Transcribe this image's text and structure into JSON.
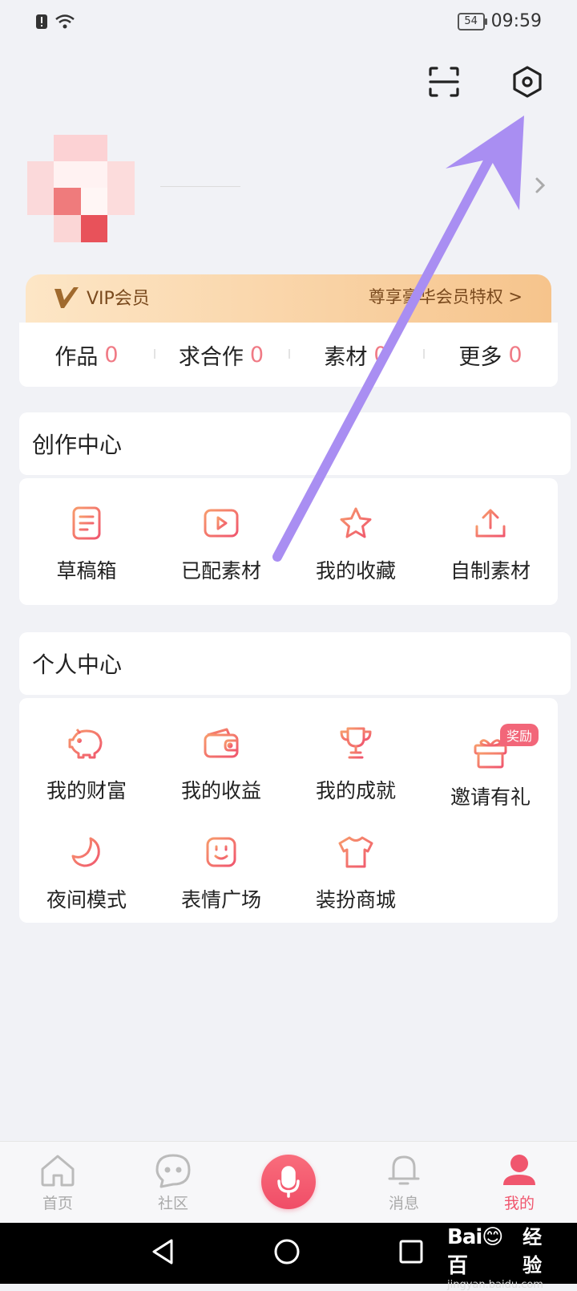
{
  "status_bar": {
    "battery": "54",
    "time": "09:59"
  },
  "icons": {
    "scan": "scan-icon",
    "settings": "settings-icon",
    "chevron": "chevron-right-icon"
  },
  "vip": {
    "label": "VIP会员",
    "promo": "尊享豪华会员特权 >"
  },
  "stats": [
    {
      "label": "作品",
      "value": "0"
    },
    {
      "label": "求合作",
      "value": "0"
    },
    {
      "label": "素材",
      "value": "0"
    },
    {
      "label": "更多",
      "value": "0"
    }
  ],
  "creation_center": {
    "title": "创作中心",
    "items": [
      {
        "label": "草稿箱",
        "icon": "document-icon"
      },
      {
        "label": "已配素材",
        "icon": "video-play-icon"
      },
      {
        "label": "我的收藏",
        "icon": "star-icon"
      },
      {
        "label": "自制素材",
        "icon": "upload-icon"
      }
    ]
  },
  "personal_center": {
    "title": "个人中心",
    "items": [
      {
        "label": "我的财富",
        "icon": "piggy-bank-icon"
      },
      {
        "label": "我的收益",
        "icon": "wallet-icon"
      },
      {
        "label": "我的成就",
        "icon": "trophy-icon"
      },
      {
        "label": "邀请有礼",
        "icon": "gift-icon",
        "badge": "奖励"
      },
      {
        "label": "夜间模式",
        "icon": "moon-icon"
      },
      {
        "label": "表情广场",
        "icon": "smiley-icon"
      },
      {
        "label": "装扮商城",
        "icon": "shirt-icon"
      }
    ]
  },
  "bottom_nav": [
    {
      "label": "首页",
      "icon": "home-icon"
    },
    {
      "label": "社区",
      "icon": "chat-bubble-icon"
    },
    {
      "label": "",
      "icon": "microphone-icon"
    },
    {
      "label": "消息",
      "icon": "bell-icon"
    },
    {
      "label": "我的",
      "icon": "person-icon",
      "active": true
    }
  ],
  "watermark": {
    "logo": "Bai😊百",
    "cn": "经验",
    "url": "jingyan.baidu.com"
  },
  "colors": {
    "accent": "#f0566e",
    "icon_gradient_start": "#f79a6c",
    "icon_gradient_end": "#f0566e",
    "annotation_arrow": "#a98ef2",
    "background": "#f1f2f6"
  }
}
